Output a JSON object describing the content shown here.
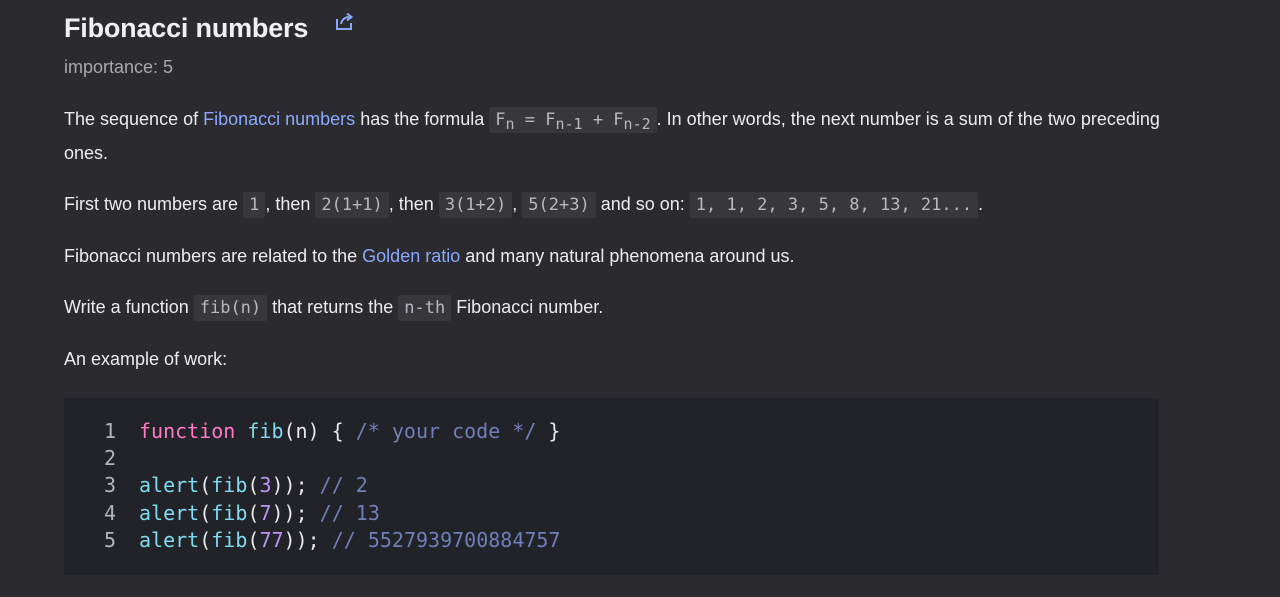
{
  "header": {
    "title": "Fibonacci numbers",
    "share_icon": "open-in-new-window-icon",
    "importance": "importance: 5"
  },
  "p1": {
    "t1": "The sequence of ",
    "link": "Fibonacci numbers",
    "t2": " has the formula ",
    "f_F": "F",
    "f_n": "n",
    "f_eq": " = F",
    "f_n1": "n-1",
    "f_plus": " + F",
    "f_n2": "n-2",
    "t3": ". In other words, the next number is a sum of the two preceding ones."
  },
  "p2": {
    "t1": "First two numbers are ",
    "c1": "1",
    "t2": ", then ",
    "c2": "2(1+1)",
    "t3": ", then ",
    "c3": "3(1+2)",
    "t4": ", ",
    "c4": "5(2+3)",
    "t5": " and so on: ",
    "c5": "1, 1, 2, 3, 5, 8, 13, 21...",
    "t6": "."
  },
  "p3": {
    "t1": "Fibonacci numbers are related to the ",
    "link": "Golden ratio",
    "t2": " and many natural phenomena around us."
  },
  "p4": {
    "t1": "Write a function ",
    "c1": "fib(n)",
    "t2": " that returns the ",
    "c2": "n-th",
    "t3": " Fibonacci number."
  },
  "p5": {
    "text": "An example of work:"
  },
  "code": {
    "line_numbers": [
      "1",
      "2",
      "3",
      "4",
      "5"
    ],
    "l1": {
      "kw": "function",
      "sp": " ",
      "fn": "fib",
      "args": "(n) { ",
      "comment": "/* your code */",
      "close": " }"
    },
    "l3": {
      "fn": "alert",
      "p1": "(",
      "fn2": "fib",
      "p2": "(",
      "num": "3",
      "p3": "));",
      "comment": " // 2"
    },
    "l4": {
      "fn": "alert",
      "p1": "(",
      "fn2": "fib",
      "p2": "(",
      "num": "7",
      "p3": "));",
      "comment": " // 13"
    },
    "l5": {
      "fn": "alert",
      "p1": "(",
      "fn2": "fib",
      "p2": "(",
      "num": "77",
      "p3": "));",
      "comment": " // 5527939700884757"
    }
  },
  "colors": {
    "background": "#2b2b2f",
    "link": "#8aa8ff",
    "keyword": "#ff7ac6",
    "function": "#7fdcf0",
    "number": "#bd93f9",
    "comment": "#6f7fb8"
  }
}
